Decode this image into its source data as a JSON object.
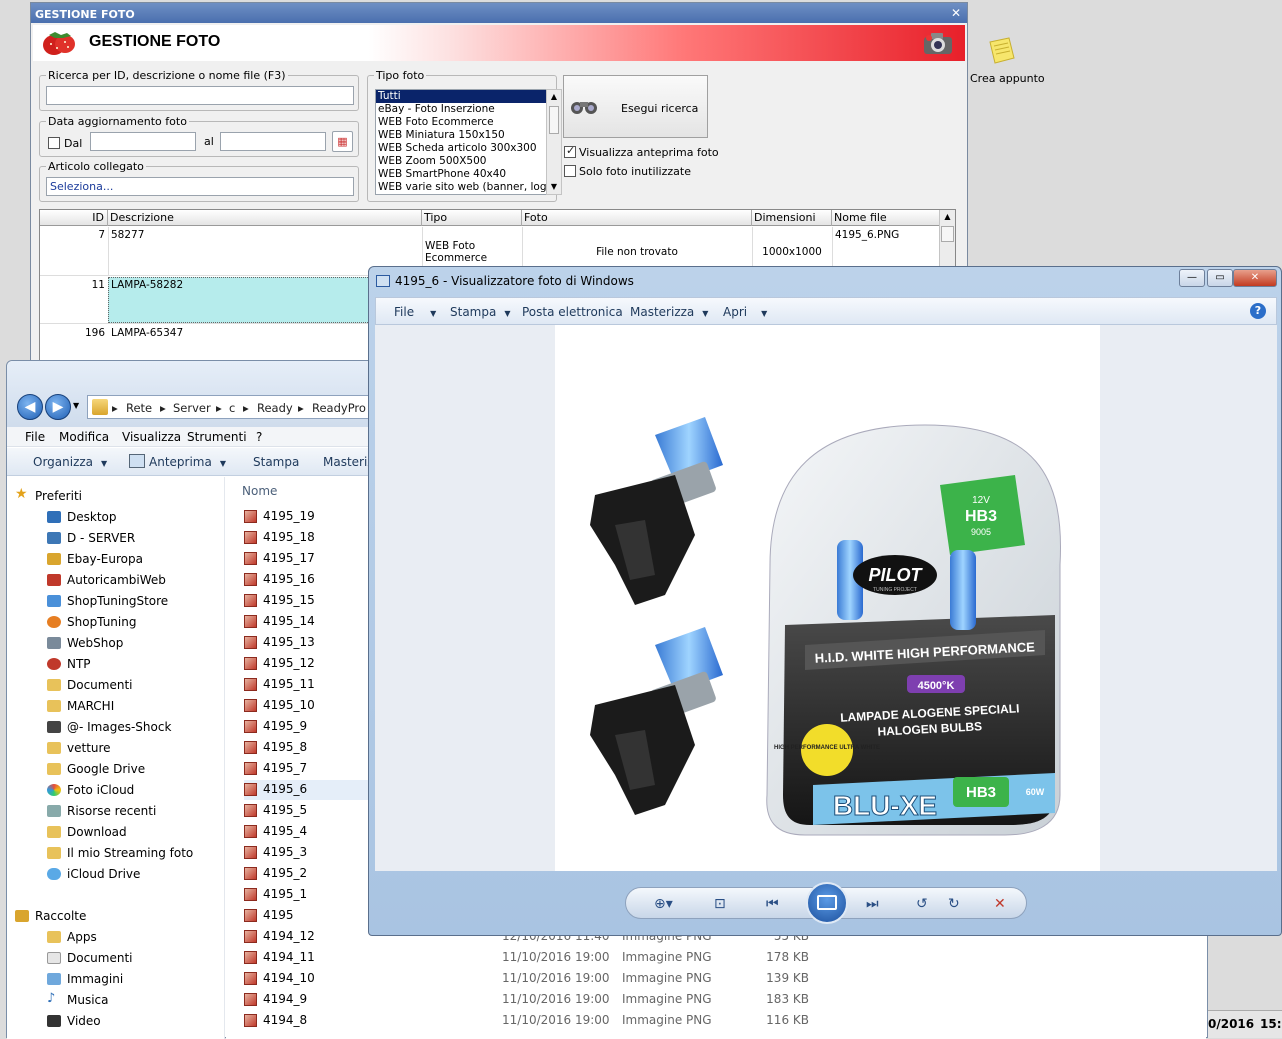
{
  "gestione": {
    "window_title": "GESTIONE FOTO",
    "heading": "GESTIONE FOTO",
    "search_label": "Ricerca per ID, descrizione o nome file (F3)",
    "search_value": "",
    "date_group_label": "Data aggiornamento foto",
    "date_from_label": "Dal",
    "date_to_label": "al",
    "articolo_label": "Articolo collegato",
    "articolo_value": "Seleziona...",
    "tipo_label": "Tipo foto",
    "tipo_options": [
      "Tutti",
      "eBay - Foto Inserzione",
      "WEB Foto Ecommerce",
      "WEB Miniatura 150x150",
      "WEB Scheda articolo 300x300",
      "WEB Zoom 500X500",
      "WEB SmartPhone 40x40",
      "WEB varie sito web (banner, log"
    ],
    "search_button": "Esegui ricerca",
    "check_preview": "Visualizza anteprima foto",
    "check_preview_checked": true,
    "check_unused": "Solo foto inutilizzate",
    "check_unused_checked": false,
    "columns": [
      "ID",
      "Descrizione",
      "Tipo",
      "Foto",
      "Dimensioni",
      "Nome file"
    ],
    "rows": [
      {
        "id": "7",
        "desc": "58277",
        "tipo": "WEB Foto Ecommerce",
        "foto": "File non trovato",
        "dim": "1000x1000",
        "file": "4195_6.PNG"
      },
      {
        "id": "11",
        "desc": "LAMPA-58282",
        "tipo": "",
        "foto": "",
        "dim": "",
        "file": ""
      },
      {
        "id": "196",
        "desc": "LAMPA-65347",
        "tipo": "",
        "foto": "",
        "dim": "",
        "file": ""
      }
    ]
  },
  "desktop_icon": {
    "label": "Crea appunto"
  },
  "explorer": {
    "breadcrumb": [
      "Rete",
      "Server",
      "c",
      "Ready",
      "ReadyPro"
    ],
    "menu": [
      "File",
      "Modifica",
      "Visualizza",
      "Strumenti",
      "?"
    ],
    "toolbar": [
      "Organizza",
      "Anteprima",
      "Stampa",
      "Masteriz"
    ],
    "favorites_title": "Preferiti",
    "favorites": [
      "Desktop",
      "D - SERVER",
      "Ebay-Europa",
      "AutoricambiWeb",
      "ShopTuningStore",
      "ShopTuning",
      "WebShop",
      "NTP",
      "Documenti",
      "MARCHI",
      "@- Images-Shock",
      "vetture",
      "Google Drive",
      "Foto iCloud",
      "Risorse recenti",
      "Download",
      "Il mio Streaming foto",
      "iCloud Drive"
    ],
    "libraries_title": "Raccolte",
    "libraries": [
      "Apps",
      "Documenti",
      "Immagini",
      "Musica",
      "Video"
    ],
    "column_name": "Nome",
    "files": [
      {
        "name": "4195_19",
        "date": "",
        "type": "",
        "size": ""
      },
      {
        "name": "4195_18",
        "date": "",
        "type": "",
        "size": ""
      },
      {
        "name": "4195_17",
        "date": "",
        "type": "",
        "size": ""
      },
      {
        "name": "4195_16",
        "date": "",
        "type": "",
        "size": ""
      },
      {
        "name": "4195_15",
        "date": "",
        "type": "",
        "size": ""
      },
      {
        "name": "4195_14",
        "date": "",
        "type": "",
        "size": ""
      },
      {
        "name": "4195_13",
        "date": "",
        "type": "",
        "size": ""
      },
      {
        "name": "4195_12",
        "date": "",
        "type": "",
        "size": ""
      },
      {
        "name": "4195_11",
        "date": "",
        "type": "",
        "size": ""
      },
      {
        "name": "4195_10",
        "date": "",
        "type": "",
        "size": ""
      },
      {
        "name": "4195_9",
        "date": "",
        "type": "",
        "size": ""
      },
      {
        "name": "4195_8",
        "date": "",
        "type": "",
        "size": ""
      },
      {
        "name": "4195_7",
        "date": "",
        "type": "",
        "size": ""
      },
      {
        "name": "4195_6",
        "date": "",
        "type": "",
        "size": ""
      },
      {
        "name": "4195_5",
        "date": "",
        "type": "",
        "size": ""
      },
      {
        "name": "4195_4",
        "date": "",
        "type": "",
        "size": ""
      },
      {
        "name": "4195_3",
        "date": "",
        "type": "",
        "size": ""
      },
      {
        "name": "4195_2",
        "date": "",
        "type": "",
        "size": ""
      },
      {
        "name": "4195_1",
        "date": "",
        "type": "",
        "size": ""
      },
      {
        "name": "4195",
        "date": "",
        "type": "",
        "size": ""
      },
      {
        "name": "4194_12",
        "date": "12/10/2016 11:40",
        "type": "Immagine PNG",
        "size": "55 KB"
      },
      {
        "name": "4194_11",
        "date": "11/10/2016 19:00",
        "type": "Immagine PNG",
        "size": "178 KB"
      },
      {
        "name": "4194_10",
        "date": "11/10/2016 19:00",
        "type": "Immagine PNG",
        "size": "139 KB"
      },
      {
        "name": "4194_9",
        "date": "11/10/2016 19:00",
        "type": "Immagine PNG",
        "size": "183 KB"
      },
      {
        "name": "4194_8",
        "date": "11/10/2016 19:00",
        "type": "Immagine PNG",
        "size": "116 KB"
      }
    ]
  },
  "viewer": {
    "title": "4195_6 - Visualizzatore foto di Windows",
    "menu": [
      "File",
      "Stampa",
      "Posta elettronica",
      "Masterizza",
      "Apri"
    ],
    "help": "?",
    "product": {
      "brand": "PILOT",
      "brand_sub": "TUNING PROJECT",
      "line1": "H.I.D. WHITE HIGH PERFORMANCE",
      "kelvin": "4500°K",
      "line2": "LAMPADE ALOGENE SPECIALI",
      "line3": "HALOGEN BULBS",
      "badge": "HIGH PERFORMANCE ULTRA WHITE",
      "model": "BLU-XE",
      "bulb": "HB3",
      "bulb_code": "9005",
      "voltage": "12V",
      "watt": "60W"
    }
  },
  "tray": {
    "date": "0/2016",
    "time": "15:1"
  }
}
